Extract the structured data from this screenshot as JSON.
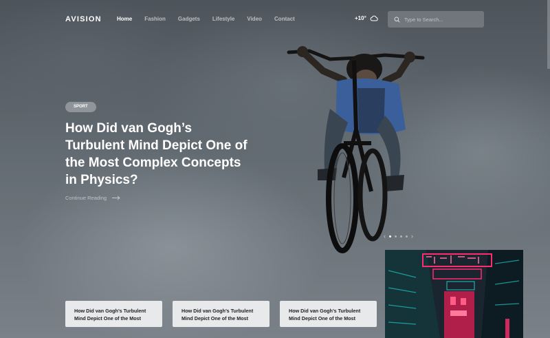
{
  "header": {
    "logo": "AVISION",
    "nav": [
      {
        "label": "Home",
        "active": true
      },
      {
        "label": "Fashion",
        "active": false
      },
      {
        "label": "Gadgets",
        "active": false
      },
      {
        "label": "Lifestyle",
        "active": false
      },
      {
        "label": "Video",
        "active": false
      },
      {
        "label": "Contact",
        "active": false
      }
    ],
    "weather": {
      "temperature": "+10°",
      "icon": "cloud-icon"
    },
    "search": {
      "placeholder": "Type to Search...",
      "icon": "search-icon"
    }
  },
  "hero": {
    "tag": "SPORT",
    "headline": "How Did van Gogh’s Turbulent Mind Depict One of the Most Complex Concepts in Physics?",
    "continue_label": "Continue Reading",
    "continue_icon": "arrow-right-icon",
    "slider": {
      "prev_icon": "chevron-left-icon",
      "next_icon": "chevron-right-icon",
      "slide_count": 4,
      "active_slide": 1
    }
  },
  "cards": [
    {
      "title": "How Did van Gogh’s Turbulent Mind Depict One of the Most"
    },
    {
      "title": "How Did van Gogh’s Turbulent Mind Depict One of the Most"
    },
    {
      "title": "How Did van Gogh’s Turbulent Mind Depict One of the Most"
    }
  ],
  "colors": {
    "text_primary": "#ffffff",
    "card_background": "#e8e9ea",
    "neon_pink": "#ff2d6f",
    "neon_cyan": "#1ec8c8"
  }
}
